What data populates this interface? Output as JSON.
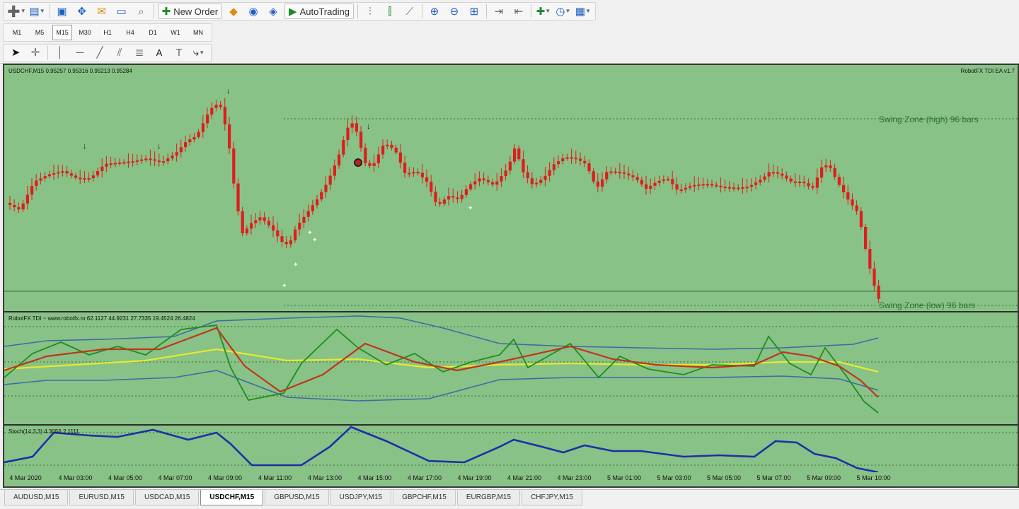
{
  "toolbar": {
    "new_order_label": "New Order",
    "autotrading_label": "AutoTrading",
    "icons": [
      "new-chart-icon",
      "profiles-icon",
      "market-watch-icon",
      "navigator-icon",
      "data-window-icon",
      "terminal-icon",
      "strategy-tester-icon",
      "new-order-icon",
      "metaeditor-icon",
      "signals-icon",
      "market-icon",
      "autotrading-icon",
      "bar-chart-icon",
      "candlestick-icon",
      "line-chart-icon",
      "zoom-in-icon",
      "zoom-out-icon",
      "tile-windows-icon",
      "autoscroll-icon",
      "chart-shift-icon",
      "indicators-icon",
      "periods-icon",
      "templates-icon"
    ]
  },
  "timeframes": [
    "M1",
    "M5",
    "M15",
    "M30",
    "H1",
    "H4",
    "D1",
    "W1",
    "MN"
  ],
  "active_timeframe": "M15",
  "drawing_tools": [
    "cursor-icon",
    "crosshair-icon",
    "vertical-line-icon",
    "horizontal-line-icon",
    "trendline-icon",
    "channel-icon",
    "fibonacci-icon",
    "text-icon",
    "text-label-icon",
    "arrows-icon"
  ],
  "chart": {
    "title": "USDCHF,M15  0.95257 0.95316 0.95213 0.95284",
    "ea_label": "RobotFX TDI EA v1.7",
    "swing_high_label": "Swing Zone (high) 96 bars",
    "swing_low_label": "Swing Zone (low) 96 bars",
    "indicator_label": "RobotFX TDI ~ www.robotfx.ro 62.1127 44.9231 27.7335 19.4524 26.4824",
    "stoch_label": "Stoch(14,3,3) 4.3056 2.1111",
    "x_ticks": [
      "4 Mar 2020",
      "4 Mar 03:00",
      "4 Mar 05:00",
      "4 Mar 07:00",
      "4 Mar 09:00",
      "4 Mar 11:00",
      "4 Mar 13:00",
      "4 Mar 15:00",
      "4 Mar 17:00",
      "4 Mar 19:00",
      "4 Mar 21:00",
      "4 Mar 23:00",
      "5 Mar 01:00",
      "5 Mar 03:00",
      "5 Mar 05:00",
      "5 Mar 07:00",
      "5 Mar 09:00",
      "5 Mar 10:00"
    ],
    "colors": {
      "background": "#88c286",
      "candle": "#e01c1c",
      "tdi_green": "#1d8f1d",
      "tdi_red": "#c0351b",
      "tdi_yellow": "#e8e830",
      "tdi_band": "#3f6aa6",
      "stoch": "#1f2ea8"
    }
  },
  "symbol_tabs": [
    "AUDUSD,M15",
    "EURUSD,M15",
    "USDCAD,M15",
    "USDCHF,M15",
    "GBPUSD,M15",
    "USDJPY,M15",
    "GBPCHF,M15",
    "EURGBP,M15",
    "CHFJPY,M15"
  ],
  "active_symbol_tab": "USDCHF,M15"
}
